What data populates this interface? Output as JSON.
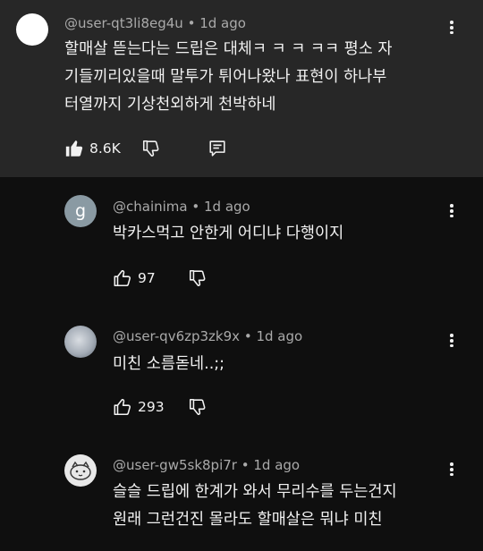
{
  "comments": [
    {
      "author": "@user-qt3li8eg4u",
      "time": "1d ago",
      "lines": [
        "할매살 뜯는다는 드립은 대체ㅋ ㅋ ㅋ ㅋㅋ 평소 자",
        "기들끼리있을때 말투가 튀어나왔나 표현이 하나부",
        "터열까지 기상천외하게 천박하네"
      ],
      "likes": "8.6K",
      "avatar_color": "#ffffff"
    },
    {
      "author": "@chainima",
      "time": "1d ago",
      "lines": [
        "박카스먹고 안한게 어디냐 다행이지"
      ],
      "likes": "97",
      "avatar_letter": "g",
      "avatar_color": "#8a9aa3"
    },
    {
      "author": "@user-qv6zp3zk9x",
      "time": "1d ago",
      "lines": [
        "미친 소름돋네..;;"
      ],
      "likes": "293"
    },
    {
      "author": "@user-gw5sk8pi7r",
      "time": "1d ago",
      "lines": [
        "슬슬 드립에 한계가 와서 무리수를 두는건지",
        "원래 그런건진 몰라도 할매살은 뭐냐 미친"
      ]
    }
  ],
  "separator": "•"
}
